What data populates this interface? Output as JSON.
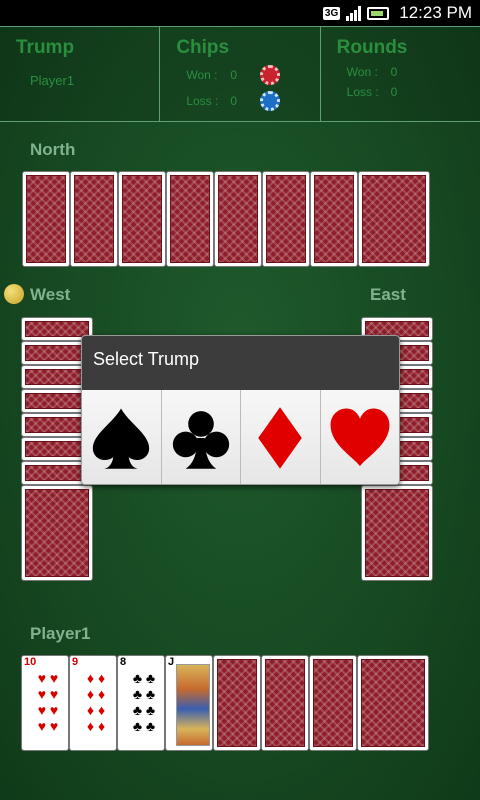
{
  "status_bar": {
    "network": "3G",
    "time": "12:23 PM"
  },
  "score_panel": {
    "trump": {
      "title": "Trump",
      "player": "Player1"
    },
    "chips": {
      "title": "Chips",
      "won_label": "Won :",
      "won_value": "0",
      "loss_label": "Loss :",
      "loss_value": "0"
    },
    "rounds": {
      "title": "Rounds",
      "won_label": "Won :",
      "won_value": "0",
      "loss_label": "Loss :",
      "loss_value": "0"
    }
  },
  "seats": {
    "north": "North",
    "west": "West",
    "east": "East",
    "player": "Player1"
  },
  "dialog": {
    "title": "Select Trump",
    "options": [
      "spade",
      "club",
      "diamond",
      "heart"
    ]
  },
  "player_hand": [
    {
      "rank": "10",
      "suit": "♥",
      "color": "red"
    },
    {
      "rank": "9",
      "suit": "♦",
      "color": "red"
    },
    {
      "rank": "8",
      "suit": "♣",
      "color": "black"
    },
    {
      "rank": "J",
      "suit": "♣",
      "color": "black"
    }
  ],
  "colors": {
    "felt": "#174a22",
    "card_back": "#8e1d2a",
    "panel_text": "#2b8e3f",
    "seat_label": "#7fb38e"
  }
}
